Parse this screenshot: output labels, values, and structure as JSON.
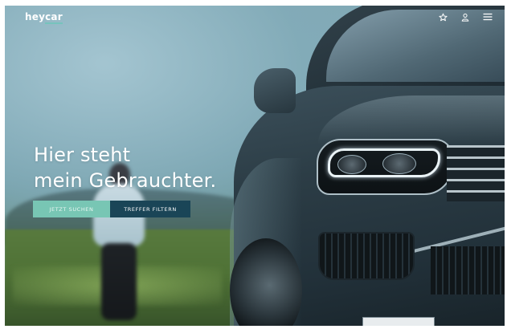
{
  "header": {
    "logo_part1": "hey",
    "logo_part2": "car",
    "icons": [
      "star-icon",
      "user-icon",
      "menu-icon"
    ]
  },
  "hero": {
    "headline_line1": "Hier steht",
    "headline_line2": "mein Gebrauchter.",
    "primary_button": "Jetzt suchen",
    "secondary_button": "Treffer filtern"
  },
  "colors": {
    "accent": "#78c6b4",
    "dark_button": "#1a4557",
    "text": "#ffffff"
  }
}
